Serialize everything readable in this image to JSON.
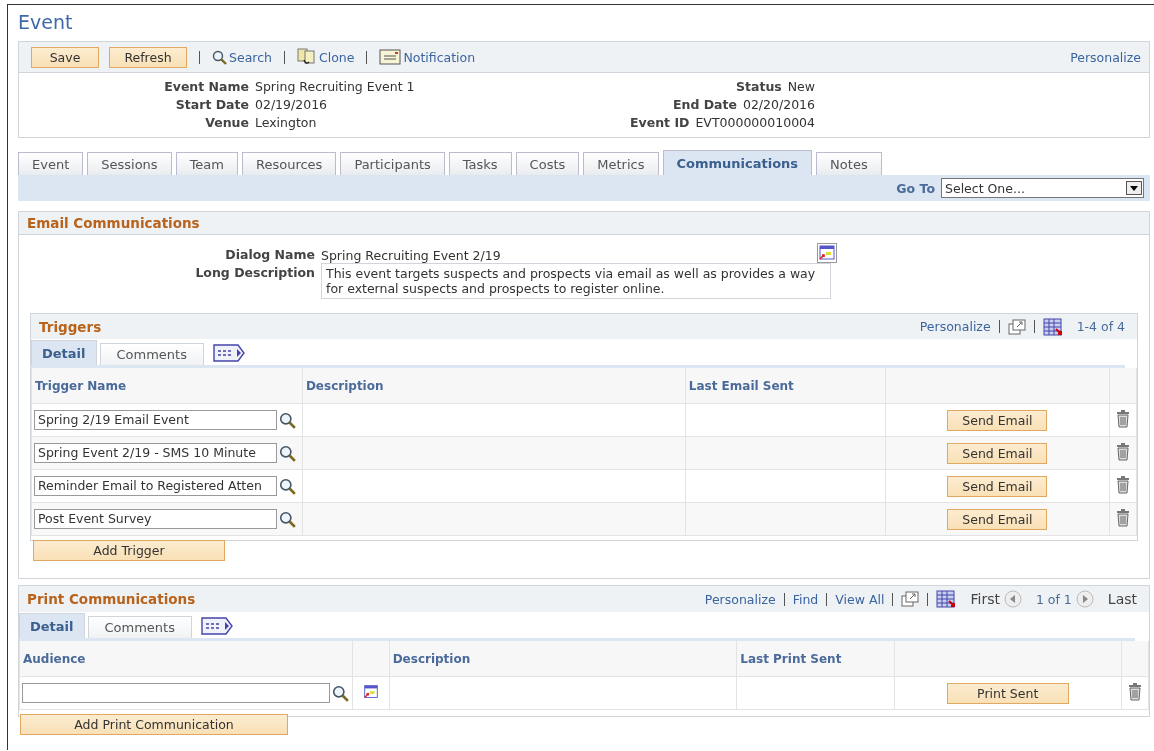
{
  "page_title": "Event",
  "toolbar": {
    "buttons": [
      "Save",
      "Refresh"
    ],
    "links": [
      {
        "kind": "search",
        "label": "Search"
      },
      {
        "kind": "clone",
        "label": "Clone"
      },
      {
        "kind": "notification",
        "label": "Notification"
      }
    ],
    "personalize": "Personalize"
  },
  "header": {
    "left": [
      {
        "label": "Event Name",
        "value": "Spring Recruiting Event 1"
      },
      {
        "label": "Start Date",
        "value": "02/19/2016"
      },
      {
        "label": "Venue",
        "value": "Lexington"
      }
    ],
    "right": [
      {
        "label": "Status",
        "value": "New"
      },
      {
        "label": "End Date",
        "value": "02/20/2016"
      },
      {
        "label": "Event ID",
        "value": "EVT000000010004"
      }
    ]
  },
  "tabs": [
    {
      "label": "Event",
      "selected": false
    },
    {
      "label": "Sessions",
      "selected": false
    },
    {
      "label": "Team",
      "selected": false
    },
    {
      "label": "Resources",
      "selected": false
    },
    {
      "label": "Participants",
      "selected": false
    },
    {
      "label": "Tasks",
      "selected": false
    },
    {
      "label": "Costs",
      "selected": false
    },
    {
      "label": "Metrics",
      "selected": false
    },
    {
      "label": "Communications",
      "selected": true
    },
    {
      "label": "Notes",
      "selected": false
    }
  ],
  "goto": {
    "label": "Go To",
    "value": "Select One..."
  },
  "email": {
    "title": "Email Communications",
    "dialog_name_label": "Dialog Name",
    "dialog_name": "Spring Recruiting Event 2/19",
    "long_desc_label": "Long Description",
    "long_desc": "This event targets suspects and prospects via email as well as provides a way for external suspects and prospects to register online.",
    "triggers": {
      "title": "Triggers",
      "personalize": "Personalize",
      "count": "1-4 of 4",
      "subtabs": [
        {
          "label": "Detail",
          "selected": true
        },
        {
          "label": "Comments",
          "selected": false
        }
      ],
      "columns": [
        "Trigger Name",
        "Description",
        "Last Email Sent"
      ],
      "rows": [
        {
          "name": "Spring 2/19 Email Event",
          "button": "Send Email"
        },
        {
          "name": "Spring Event 2/19 - SMS 10 Minute",
          "button": "Send Email"
        },
        {
          "name": "Reminder Email to Registered Atten",
          "button": "Send Email"
        },
        {
          "name": "Post Event Survey",
          "button": "Send Email"
        }
      ],
      "add_button": "Add Trigger"
    }
  },
  "print": {
    "title": "Print Communications",
    "links": [
      "Personalize",
      "Find",
      "View All"
    ],
    "nav": {
      "first": "First",
      "range": "1 of 1",
      "last": "Last"
    },
    "subtabs": [
      {
        "label": "Detail",
        "selected": true
      },
      {
        "label": "Comments",
        "selected": false
      }
    ],
    "columns": [
      "Audience",
      "Description",
      "Last Print Sent"
    ],
    "rows": [
      {
        "button": "Print Sent"
      }
    ],
    "add_button": "Add Print Communication"
  }
}
